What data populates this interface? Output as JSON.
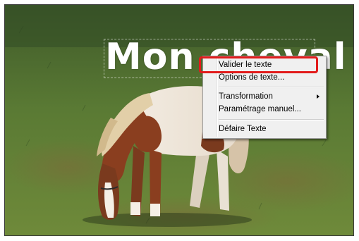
{
  "canvas": {
    "text_layer": "Mon cheval"
  },
  "context_menu": {
    "items": [
      {
        "label": "Valider le texte"
      },
      {
        "label": "Options de texte..."
      },
      {
        "label": "Transformation",
        "has_submenu": true
      },
      {
        "label": "Paramétrage manuel..."
      },
      {
        "label": "Défaire Texte"
      }
    ]
  },
  "colors": {
    "highlight": "#e21b1b",
    "menu_background": "#f0f0f0"
  }
}
